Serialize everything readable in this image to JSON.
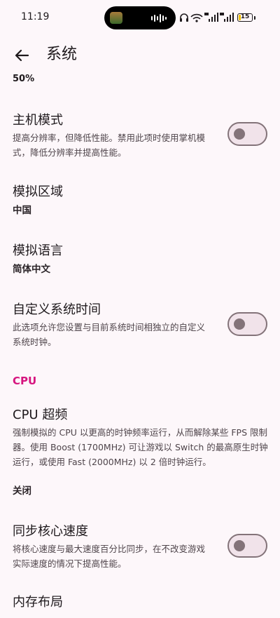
{
  "status_bar": {
    "time": "11:19",
    "battery_level": "15",
    "battery_fraction": 0.15,
    "icons": [
      "headphones-icon",
      "wifi-6-icon",
      "signal-5g-icon",
      "signal-5g-icon",
      "battery-icon"
    ]
  },
  "header": {
    "title": "系统",
    "back_icon": "arrow-left-icon"
  },
  "cut_off_value": "50%",
  "settings": {
    "host_mode": {
      "title": "主机模式",
      "description": "提高分辨率，但降低性能。禁用此项时使用掌机模式，降低分辨率并提高性能。",
      "enabled": false
    },
    "region": {
      "title": "模拟区域",
      "value": "中国"
    },
    "language": {
      "title": "模拟语言",
      "value": "简体中文"
    },
    "custom_time": {
      "title": "自定义系统时间",
      "description": "此选项允许您设置与目前系统时间相独立的自定义系统时钟。",
      "enabled": false
    },
    "cpu_section": "CPU",
    "cpu_overclock": {
      "title": "CPU 超频",
      "description": "强制模拟的 CPU 以更高的时钟频率运行，从而解除某些 FPS 限制器。使用 Boost (1700MHz) 可让游戏以 Switch 的最高原生时钟运行，或使用 Fast (2000MHz) 以 2 倍时钟运行。",
      "value": "关闭"
    },
    "sync_core": {
      "title": "同步核心速度",
      "description": "将核心速度与最大速度百分比同步，在不改变游戏实际速度的情况下提高性能。",
      "enabled": false
    },
    "memory_layout": {
      "title": "内存布局"
    }
  },
  "colors": {
    "background": "#fdf7fa",
    "accent": "#d6157f",
    "switch_outline": "#837379",
    "switch_track": "#f1e3ea"
  }
}
